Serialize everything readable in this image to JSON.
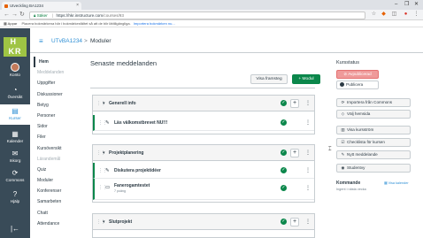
{
  "browser": {
    "tab_title": "Utveckling BA1234",
    "tab_close": "×",
    "window_controls": [
      "–",
      "❐",
      "✕"
    ],
    "secure_label": "Säker",
    "url_domain": "hkr.instructure.com",
    "url_path": "/courses/93",
    "bookmarks_apps": "Appar",
    "bookmarks_info": "Placera bokmärkena här i bokmärkesfältet så att de blir lättillgängliga.",
    "bookmarks_import": "Importera bokmärken nu..."
  },
  "global_nav": {
    "logo_text": "HKR",
    "items": [
      {
        "label": "Konto",
        "icon": "avatar"
      },
      {
        "label": "Översikt",
        "icon": "dashboard-icon",
        "glyph": "◔"
      },
      {
        "label": "Kurser",
        "icon": "courses-icon",
        "glyph": "▤",
        "active": true
      },
      {
        "label": "Kalender",
        "icon": "calendar-icon",
        "glyph": "▦"
      },
      {
        "label": "Inkorg",
        "icon": "inbox-icon",
        "glyph": "✉"
      },
      {
        "label": "Commons",
        "icon": "commons-icon",
        "glyph": "⟳"
      },
      {
        "label": "Hjälp",
        "icon": "help-icon",
        "glyph": "?"
      }
    ],
    "collapse_glyph": "|←"
  },
  "breadcrumb": {
    "menu_glyph": "≡",
    "course": "UTvBA1234",
    "separator": ">",
    "page": "Moduler"
  },
  "course_nav": [
    {
      "label": "Hem",
      "state": "active"
    },
    {
      "label": "Meddelanden",
      "state": "disabled"
    },
    {
      "label": "Uppgifter",
      "state": "normal"
    },
    {
      "label": "Diskussioner",
      "state": "normal"
    },
    {
      "label": "Betyg",
      "state": "normal"
    },
    {
      "label": "Personer",
      "state": "normal"
    },
    {
      "label": "Sidor",
      "state": "normal"
    },
    {
      "label": "Filer",
      "state": "normal"
    },
    {
      "label": "Kursöversikt",
      "state": "normal"
    },
    {
      "label": "Lärandemål",
      "state": "disabled"
    },
    {
      "label": "Quiz",
      "state": "normal"
    },
    {
      "label": "Moduler",
      "state": "normal"
    },
    {
      "label": "Konferenser",
      "state": "normal"
    },
    {
      "label": "Samarbeten",
      "state": "normal"
    },
    {
      "label": "Chatt",
      "state": "normal"
    },
    {
      "label": "Attendance",
      "state": "normal"
    }
  ],
  "main": {
    "title": "Senaste meddelanden",
    "view_progress": "Visa framsteg",
    "add_module": "+ Modul",
    "modules": [
      {
        "name": "Generell info",
        "items": [
          {
            "icon": "discussion-icon",
            "glyph": "✎",
            "name": "Läs välkomstbrevet NU!!!",
            "sub": ""
          }
        ]
      },
      {
        "name": "Projektplanering",
        "items": [
          {
            "icon": "discussion-icon",
            "glyph": "✎",
            "name": "Diskutera projektidéer",
            "sub": ""
          },
          {
            "icon": "page-icon",
            "glyph": "▭",
            "name": "Fanerogamtestet",
            "sub": "7 poäng"
          }
        ]
      },
      {
        "name": "Slutprojekt",
        "items": []
      }
    ]
  },
  "sidebar": {
    "title": "Kursstatus",
    "unpublished": "Avpublicerad",
    "publish": "Publicera",
    "actions": [
      {
        "label": "Importera från Commons",
        "glyph": "⟳",
        "icon": "commons-icon"
      },
      {
        "label": "Välj hemsida",
        "glyph": "◇",
        "icon": "home-page-icon"
      },
      {
        "label": "Visa kursström",
        "glyph": "▥",
        "icon": "stream-icon"
      },
      {
        "label": "Checklista för kursen",
        "glyph": "☑",
        "icon": "checklist-icon"
      },
      {
        "label": "Nytt meddelande",
        "glyph": "✎",
        "icon": "announcement-icon"
      },
      {
        "label": "Studentvy",
        "glyph": "◉",
        "icon": "student-view-icon"
      }
    ],
    "coming_up": "Kommande",
    "calendar_link": "Visa kalender",
    "coming_up_empty": "Ingent i nästa vecka"
  },
  "colors": {
    "global_nav": "#394b58",
    "accent": "#2d8fd5",
    "publish_green": "#0b874b",
    "unpublished_red": "#ef9a9a"
  }
}
